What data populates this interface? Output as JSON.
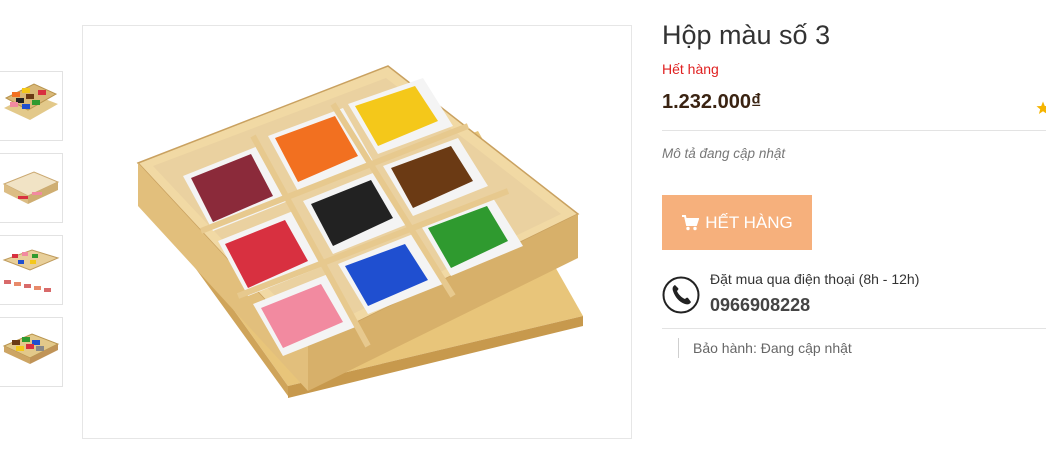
{
  "product": {
    "title": "Hộp màu số 3",
    "stock_status": "Hết hàng",
    "price": "1.232.000₫",
    "description": "Mô tả đang cập nhật",
    "buy_button_label": "HẾT HÀNG",
    "phone_order_label": "Đặt mua qua điện thoại (8h - 12h)",
    "phone_number": "0966908228",
    "warranty": "Bảo hành: Đang cập nhật",
    "rating_icon": "star-icon"
  },
  "thumbnails": [
    {
      "name": "thumbnail-1",
      "description_icon": "color-box-image"
    },
    {
      "name": "thumbnail-2",
      "description_icon": "color-box-closed-image"
    },
    {
      "name": "thumbnail-3",
      "description_icon": "color-box-with-tablets-image"
    },
    {
      "name": "thumbnail-4",
      "description_icon": "color-box-top-view-image"
    }
  ],
  "colors": {
    "price": "#3a2312",
    "stock": "#e02020",
    "button": "#f6b07c",
    "tablet_colors": [
      "#8b2a3a",
      "#f27020",
      "#f4c81a",
      "#d83040",
      "#222222",
      "#6b3a14",
      "#f28aa0",
      "#1f4fd0",
      "#2f9a2f"
    ]
  }
}
